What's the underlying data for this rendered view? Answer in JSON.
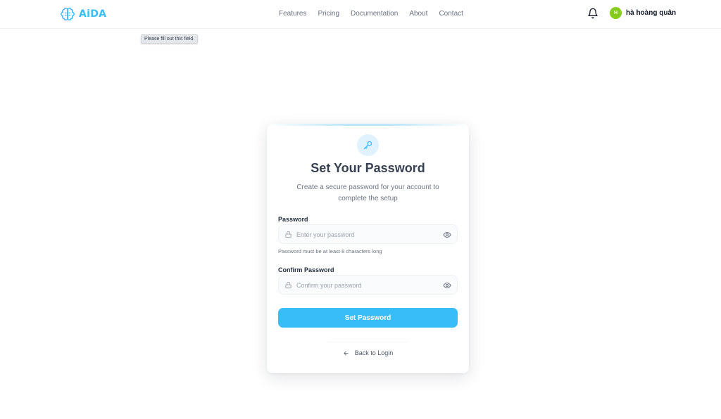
{
  "brand": {
    "name": "AiDA",
    "color": "#38bdf8"
  },
  "nav": {
    "items": [
      {
        "label": "Features"
      },
      {
        "label": "Pricing"
      },
      {
        "label": "Documentation"
      },
      {
        "label": "About"
      },
      {
        "label": "Contact"
      }
    ]
  },
  "user": {
    "initial": "H",
    "name": "hà hoàng quân",
    "avatar_color": "#84cc16"
  },
  "tooltip": {
    "text": "Please fill out this field."
  },
  "card": {
    "title": "Set Your Password",
    "subtitle": "Create a secure password for your account to complete the setup",
    "password": {
      "label": "Password",
      "placeholder": "Enter your password",
      "value": "",
      "hint": "Password must be at least 8 characters long"
    },
    "confirm": {
      "label": "Confirm Password",
      "placeholder": "Confirm your password",
      "value": ""
    },
    "submit_label": "Set Password",
    "back_label": "Back to Login"
  },
  "icons": {
    "logo": "brain-icon",
    "bell": "bell-icon",
    "key": "key-icon",
    "lock": "lock-icon",
    "eye": "eye-icon",
    "back": "arrow-left-icon"
  }
}
